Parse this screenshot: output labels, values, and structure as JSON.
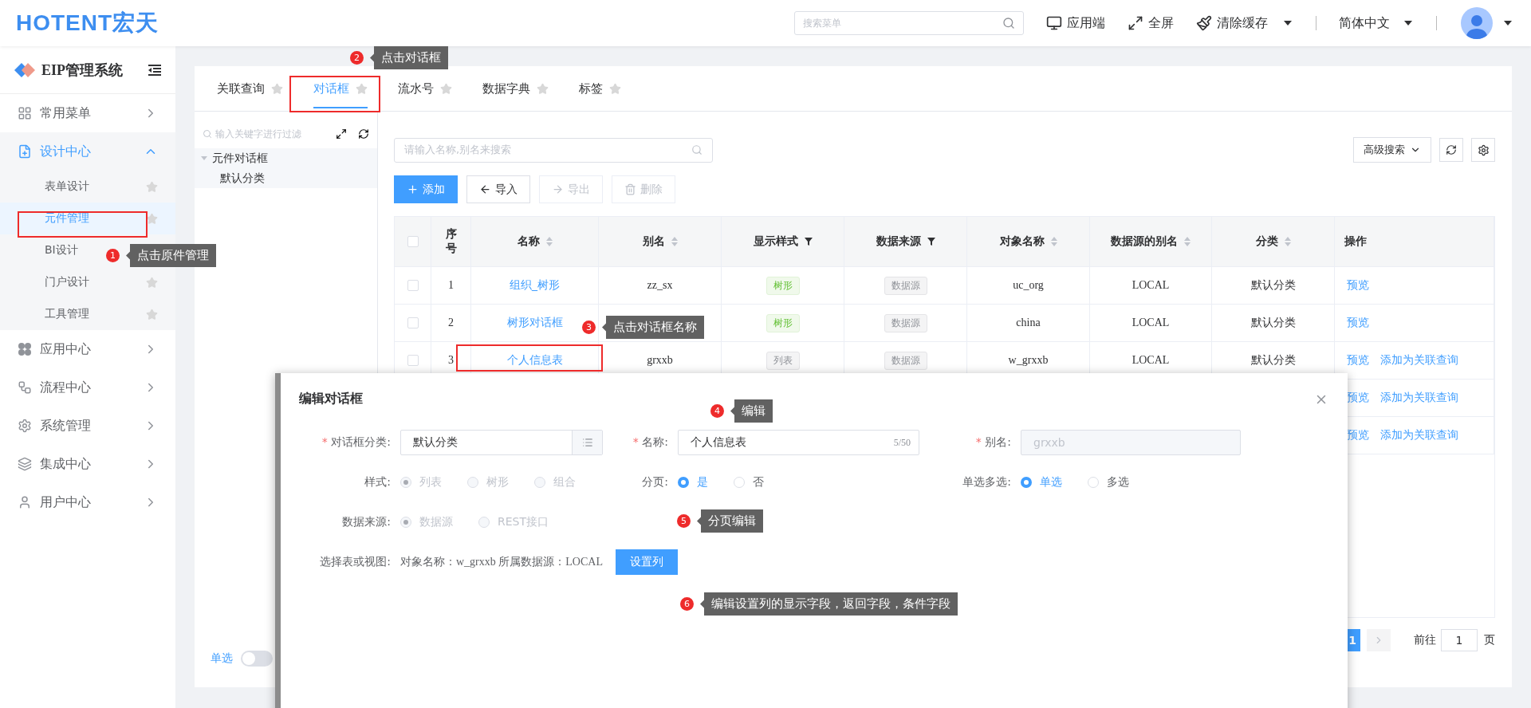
{
  "header": {
    "logo": "HOTENT宏天",
    "search_placeholder": "搜索菜单",
    "actions": [
      {
        "label": "应用端",
        "dropdown": false
      },
      {
        "label": "全屏",
        "dropdown": false
      },
      {
        "label": "清除缓存",
        "dropdown": true
      }
    ],
    "language": "简体中文"
  },
  "sidebar": {
    "title": "EIP管理系统",
    "items": [
      {
        "label": "常用菜单",
        "expanded": false
      },
      {
        "label": "设计中心",
        "expanded": true,
        "children": [
          {
            "label": "表单设计",
            "selected": false
          },
          {
            "label": "元件管理",
            "selected": true
          },
          {
            "label": "BI设计",
            "selected": false
          },
          {
            "label": "门户设计",
            "selected": false
          },
          {
            "label": "工具管理",
            "selected": false
          }
        ]
      },
      {
        "label": "应用中心",
        "expanded": false
      },
      {
        "label": "流程中心",
        "expanded": false
      },
      {
        "label": "系统管理",
        "expanded": false
      },
      {
        "label": "集成中心",
        "expanded": false
      },
      {
        "label": "用户中心",
        "expanded": false
      }
    ]
  },
  "tabs": [
    {
      "label": "关联查询",
      "selected": false
    },
    {
      "label": "对话框",
      "selected": true
    },
    {
      "label": "流水号",
      "selected": false
    },
    {
      "label": "数据字典",
      "selected": false
    },
    {
      "label": "标签",
      "selected": false
    }
  ],
  "tree": {
    "filter_placeholder": "输入关键字进行过滤",
    "nodes": [
      {
        "label": "元件对话框",
        "expanded": true,
        "children": [
          {
            "label": "默认分类"
          }
        ]
      }
    ],
    "toggle": {
      "label": "单选",
      "on": false
    }
  },
  "toolbar": {
    "search_placeholder": "请输入名称,别名来搜索",
    "buttons": [
      {
        "label": "添加",
        "kind": "add",
        "disabled": false
      },
      {
        "label": "导入",
        "kind": "import",
        "disabled": false
      },
      {
        "label": "导出",
        "kind": "export",
        "disabled": true
      },
      {
        "label": "删除",
        "kind": "delete",
        "disabled": true
      }
    ],
    "advanced_search": "高级搜索"
  },
  "table": {
    "columns": [
      {
        "kind": "checkbox",
        "checked": false
      },
      {
        "label": "序号",
        "kind": "plain"
      },
      {
        "label": "名称",
        "kind": "sort"
      },
      {
        "label": "别名",
        "kind": "sort"
      },
      {
        "label": "显示样式",
        "kind": "filter"
      },
      {
        "label": "数据来源",
        "kind": "filter"
      },
      {
        "label": "对象名称",
        "kind": "sort"
      },
      {
        "label": "数据源的别名",
        "kind": "sort"
      },
      {
        "label": "分类",
        "kind": "sort"
      },
      {
        "label": "操作",
        "kind": "plain"
      }
    ],
    "rows": [
      {
        "checked": false,
        "index": "1",
        "name": "组织_树形",
        "alias": "zz_sx",
        "style": {
          "label": "树形",
          "kind": "tree"
        },
        "source": "数据源",
        "object": "uc_org",
        "source_alias": "LOCAL",
        "category": "默认分类",
        "actions": [
          "预览"
        ]
      },
      {
        "checked": false,
        "index": "2",
        "name": "树形对话框",
        "style": {
          "label": "树形",
          "kind": "tree"
        },
        "source": "数据源",
        "object": "china",
        "source_alias": "LOCAL",
        "category": "默认分类",
        "actions": [
          "预览"
        ]
      },
      {
        "checked": false,
        "index": "3",
        "name": "个人信息表",
        "alias": "grxxb",
        "style": {
          "label": "列表",
          "kind": "list"
        },
        "source": "数据源",
        "object": "w_grxxb",
        "source_alias": "LOCAL",
        "category": "默认分类",
        "actions": [
          "预览",
          "添加为关联查询"
        ]
      },
      {
        "actions": [
          "预览",
          "添加为关联查询"
        ]
      },
      {
        "actions": [
          "预览",
          "添加为关联查询"
        ]
      }
    ]
  },
  "pagination": {
    "page": "1",
    "goto_label": "前往",
    "goto_value": "1",
    "suffix": "页"
  },
  "dialog": {
    "title": "编辑对话框",
    "rows": [
      {
        "fields": [
          {
            "kind": "select",
            "mark": "*",
            "label": "对话框分类:",
            "value": "默认分类"
          },
          {
            "kind": "text",
            "mark": "*",
            "label": "名称:",
            "value": "个人信息表",
            "counter": "5/50",
            "disabled": false
          },
          {
            "kind": "text",
            "mark": "*",
            "label": "别名:",
            "value": "grxxb",
            "disabled": true
          }
        ]
      },
      {
        "fields": [
          {
            "kind": "radio",
            "label": "样式:",
            "options": [
              {
                "label": "列表",
                "selected": true,
                "disabled": true
              },
              {
                "label": "树形",
                "selected": false,
                "disabled": true
              },
              {
                "label": "组合",
                "selected": false,
                "disabled": true
              }
            ]
          },
          {
            "kind": "radio",
            "label": "分页:",
            "options": [
              {
                "label": "是",
                "selected": true,
                "disabled": false
              },
              {
                "label": "否",
                "selected": false,
                "disabled": false
              }
            ]
          },
          {
            "kind": "radio",
            "label": "单选多选:",
            "options": [
              {
                "label": "单选",
                "selected": true,
                "disabled": false
              },
              {
                "label": "多选",
                "selected": false,
                "disabled": false
              }
            ]
          }
        ]
      },
      {
        "fields": [
          {
            "kind": "radio",
            "label": "数据来源:",
            "options": [
              {
                "label": "数据源",
                "selected": true,
                "disabled": true
              },
              {
                "label": "REST接口",
                "selected": false,
                "disabled": true
              }
            ]
          }
        ]
      },
      {
        "fields": [
          {
            "kind": "info",
            "label": "选择表或视图:",
            "text": "对象名称：w_grxxb 所属数据源：LOCAL",
            "button": "设置列"
          }
        ]
      }
    ]
  },
  "annotations": [
    {
      "number": "1",
      "text": "点击原件管理"
    },
    {
      "number": "2",
      "text": "点击对话框"
    },
    {
      "number": "3",
      "text": "点击对话框名称"
    },
    {
      "number": "4",
      "text": "编辑"
    },
    {
      "number": "5",
      "text": "分页编辑"
    },
    {
      "number": "6",
      "text": "编辑设置列的显示字段，返回字段，条件字段"
    }
  ]
}
